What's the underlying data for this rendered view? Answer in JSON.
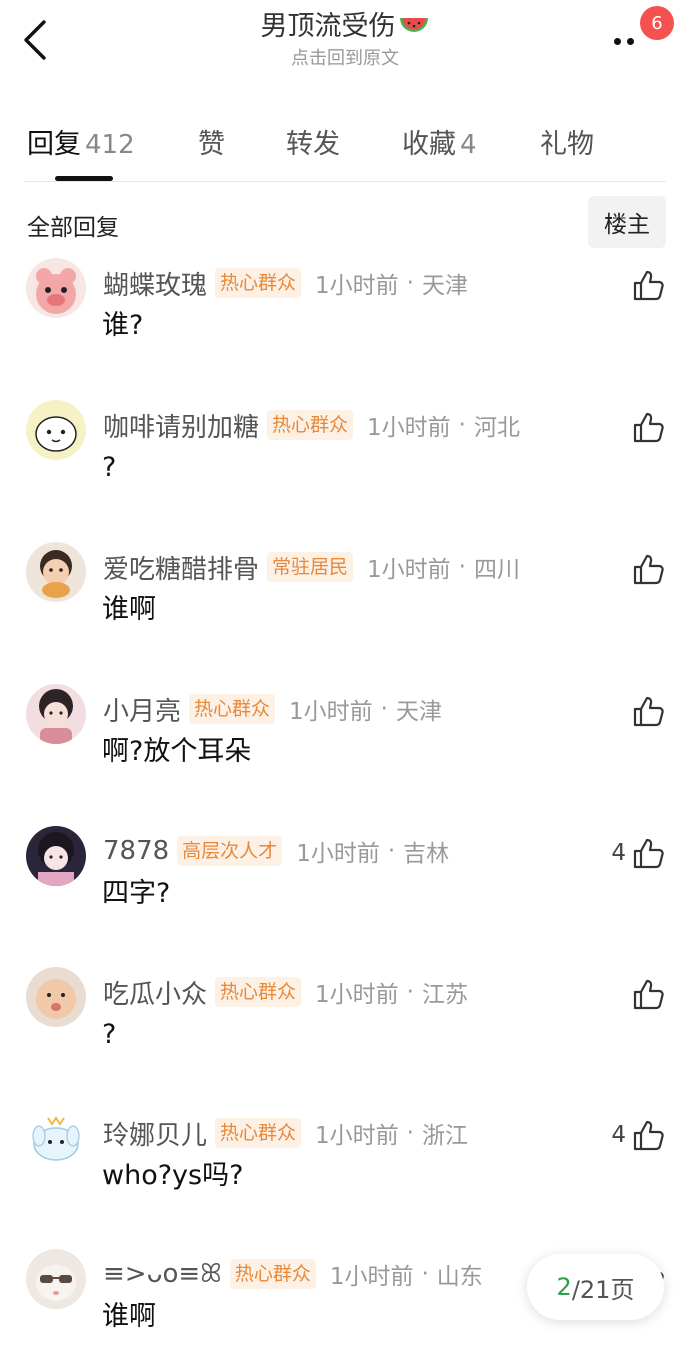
{
  "header": {
    "title": "男顶流受伤",
    "title_emoji": "watermelon-emoji",
    "subtitle": "点击回到原文",
    "notification_count": "6"
  },
  "tabs": [
    {
      "label": "回复",
      "count": "412",
      "active": true
    },
    {
      "label": "赞",
      "count": ""
    },
    {
      "label": "转发",
      "count": ""
    },
    {
      "label": "收藏",
      "count": "4"
    },
    {
      "label": "礼物",
      "count": ""
    }
  ],
  "section": {
    "title": "全部回复",
    "op_button": "楼主"
  },
  "comments": [
    {
      "user": "蝴蝶玫瑰",
      "tag": "热心群众",
      "time": "1小时前",
      "location": "天津",
      "text": "谁?",
      "likes": ""
    },
    {
      "user": "咖啡请别加糖",
      "tag": "热心群众",
      "time": "1小时前",
      "location": "河北",
      "text": "?",
      "likes": ""
    },
    {
      "user": "爱吃糖醋排骨",
      "tag": "常驻居民",
      "time": "1小时前",
      "location": "四川",
      "text": "谁啊",
      "likes": ""
    },
    {
      "user": "小月亮",
      "tag": "热心群众",
      "time": "1小时前",
      "location": "天津",
      "text": "啊?放个耳朵",
      "likes": ""
    },
    {
      "user": "7878",
      "tag": "高层次人才",
      "time": "1小时前",
      "location": "吉林",
      "text": "四字?",
      "likes": "4"
    },
    {
      "user": "吃瓜小众",
      "tag": "热心群众",
      "time": "1小时前",
      "location": "江苏",
      "text": "?",
      "likes": ""
    },
    {
      "user": "玲娜贝儿",
      "tag": "热心群众",
      "time": "1小时前",
      "location": "浙江",
      "text": "who?ys吗?",
      "likes": "4"
    },
    {
      "user": "≡>ᴗo≡ꕤ",
      "tag": "热心群众",
      "time": "1小时前",
      "location": "山东",
      "text": "谁啊",
      "likes": ""
    }
  ],
  "meta_separator": "·",
  "pager": {
    "current": "2",
    "total": "/21页"
  },
  "colors": {
    "tag_orange_text": "#e8893a",
    "tag_orange_bg": "#fdf1e6",
    "badge_red": "#f5514e",
    "pager_green": "#2aa14b"
  },
  "icons": {
    "back": "chevron-left-icon",
    "more": "more-dots-icon",
    "like": "thumb-up-icon"
  }
}
